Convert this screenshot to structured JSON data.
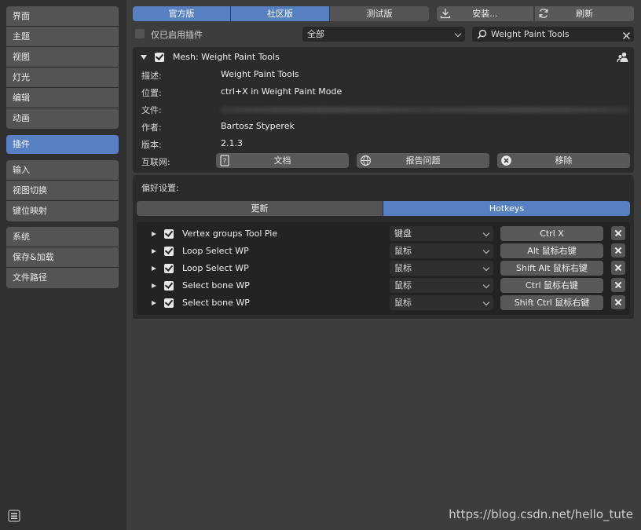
{
  "sidebar": {
    "group1": [
      "界面",
      "主题",
      "视图",
      "灯光",
      "编辑",
      "动画"
    ],
    "active": "插件",
    "group2": [
      "输入",
      "视图切换",
      "键位映射"
    ],
    "group3": [
      "系统",
      "保存&加载",
      "文件路径"
    ]
  },
  "top_tabs": [
    "官方版",
    "社区版",
    "测试版"
  ],
  "install_label": "安装...",
  "refresh_label": "刷新",
  "enabled_only_label": "仅已启用插件",
  "category_filter": "全部",
  "search_value": "Weight Paint Tools",
  "addon": {
    "title": "Mesh: Weight Paint Tools",
    "desc_label": "描述:",
    "desc_value": "Weight Paint Tools",
    "location_label": "位置:",
    "location_value": "ctrl+X in Weight Paint Mode",
    "file_label": "文件:",
    "author_label": "作者:",
    "author_value": "Bartosz Styperek",
    "version_label": "版本:",
    "version_value": "2.1.3",
    "internet_label": "互联网:",
    "docs_button": "文档",
    "report_button": "报告问题",
    "remove_button": "移除"
  },
  "prefs": {
    "label": "偏好设置:",
    "tabs": [
      "更新",
      "Hotkeys"
    ],
    "rows": [
      {
        "name": "Vertex groups Tool Pie",
        "type": "键盘",
        "key": "Ctrl X"
      },
      {
        "name": "Loop Select WP",
        "type": "鼠标",
        "key": "Alt 鼠标右键"
      },
      {
        "name": "Loop Select WP",
        "type": "鼠标",
        "key": "Shift Alt 鼠标右键"
      },
      {
        "name": "Select bone WP",
        "type": "鼠标",
        "key": "Ctrl 鼠标右键"
      },
      {
        "name": "Select bone WP",
        "type": "鼠标",
        "key": "Shift Ctrl 鼠标右键"
      }
    ]
  },
  "watermark": "https://blog.csdn.net/hello_tute",
  "colors": {
    "accent": "#5680c2",
    "background": "#3d3d3d",
    "sidebar": "#303030",
    "panel": "#2b2b2b"
  }
}
